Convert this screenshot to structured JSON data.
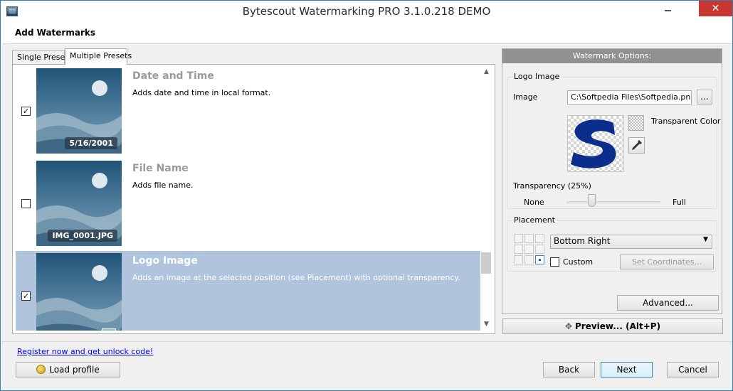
{
  "window": {
    "title": "Bytescout Watermarking PRO 3.1.0.218 DEMO",
    "close_glyph": "✕"
  },
  "header": {
    "title": "Add Watermarks"
  },
  "tabs": [
    {
      "label": "Single Preset",
      "active": false
    },
    {
      "label": "Multiple Presets",
      "active": true
    }
  ],
  "presets": [
    {
      "name": "Date and Time",
      "description": "Adds date and time in local format.",
      "checked": true,
      "stamp": "5/16/2001",
      "selected": false
    },
    {
      "name": "File Name",
      "description": "Adds file name.",
      "checked": false,
      "stamp": "IMG_0001.JPG",
      "selected": false
    },
    {
      "name": "Logo Image",
      "description": "Adds an image at the selected position (see Placement) with optional transparency.",
      "checked": true,
      "stamp": "",
      "selected": true
    }
  ],
  "options": {
    "header": "Watermark Options:",
    "logo_group": "Logo Image",
    "image_label": "Image",
    "image_path": "C:\\Softpedia Files\\Softpedia.png",
    "browse_label": "...",
    "transparent_color_label": "Transparent Color",
    "transparency_label": "Transparency (25%)",
    "transparency_value": 25,
    "none_label": "None",
    "full_label": "Full",
    "placement_group": "Placement",
    "placement_value": "Bottom Right",
    "custom_label": "Custom",
    "custom_checked": false,
    "set_coordinates_label": "Set Coordinates...",
    "advanced_label": "Advanced..."
  },
  "preview_label": "Preview... (Alt+P)",
  "footer": {
    "register_link": "Register now and get unlock code!",
    "load_profile": "Load profile",
    "back": "Back",
    "next": "Next",
    "cancel": "Cancel"
  },
  "colors": {
    "selection": "#b0c4de",
    "options_header": "#919191",
    "close_button": "#c7372f",
    "logo_blue": "#0b2d8c"
  },
  "icons": {
    "app": "app-icon",
    "load_profile": "coin-icon",
    "preview": "move-cross-icon",
    "eyedropper": "eyedropper-icon"
  }
}
